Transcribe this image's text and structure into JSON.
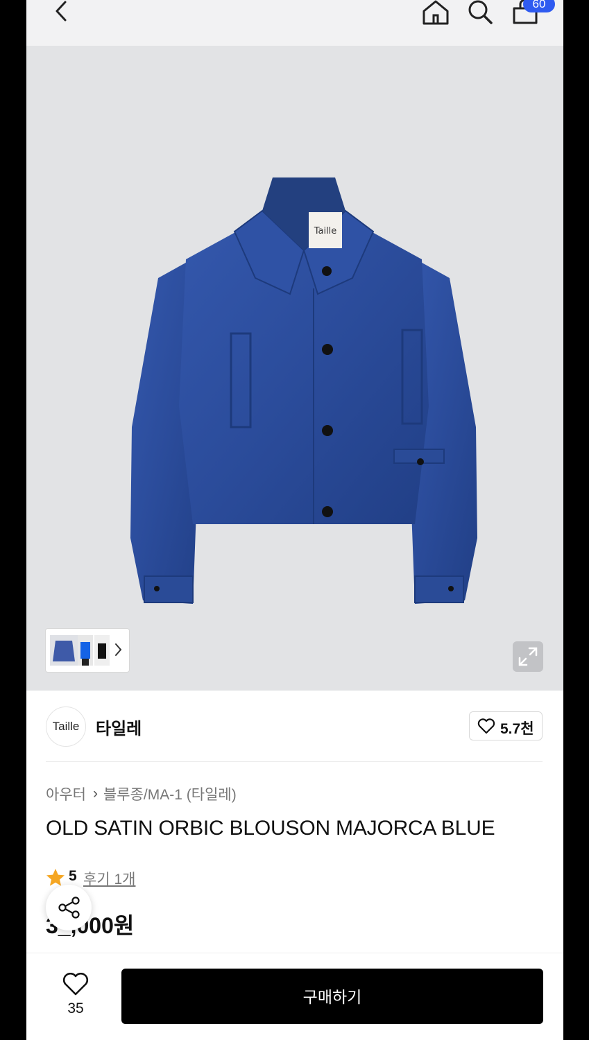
{
  "header": {
    "back_icon": "chevron-left-icon",
    "home_icon": "home-icon",
    "search_icon": "search-icon",
    "cart_icon": "shopping-bag-icon",
    "cart_count": "60",
    "badge_color": "#2f5bf0"
  },
  "hero": {
    "product_label_text": "Taille",
    "expand_icon": "expand-icon",
    "thumbnail_chevron": "chevron-right-icon",
    "jacket_color": "#2b4c9b"
  },
  "brand": {
    "logo_text": "Taille",
    "name": "타일레",
    "like_icon": "heart-outline-icon",
    "like_count": "5.7천"
  },
  "product": {
    "breadcrumb": [
      "아우터",
      "블루종/MA-1 (타일레)"
    ],
    "title": "OLD SATIN ORBIC BLOUSON MAJORCA BLUE",
    "rating_icon": "star-icon",
    "rating": "5",
    "review_link": "후기 1개",
    "price": "3_,000원",
    "share_icon": "share-icon",
    "star_color": "#f5a623"
  },
  "bottom_bar": {
    "wish_icon": "heart-outline-icon",
    "wish_count": "35",
    "buy_label": "구매하기"
  }
}
